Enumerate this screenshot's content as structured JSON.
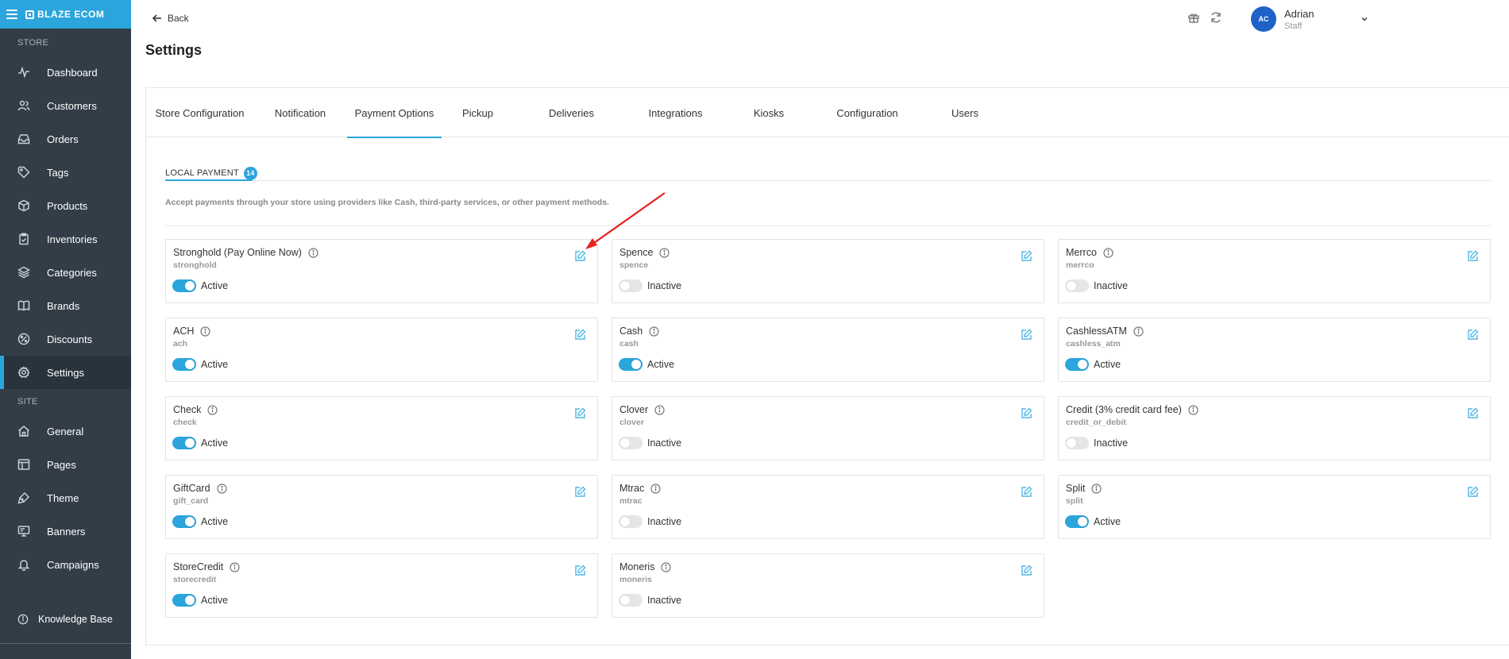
{
  "sidebar": {
    "brand": "BLAZE ECOM",
    "store_section": "STORE",
    "site_section": "SITE",
    "store_items": [
      {
        "label": "Dashboard",
        "icon": "activity-icon"
      },
      {
        "label": "Customers",
        "icon": "users-icon"
      },
      {
        "label": "Orders",
        "icon": "inbox-icon"
      },
      {
        "label": "Tags",
        "icon": "tag-icon"
      },
      {
        "label": "Products",
        "icon": "package-icon"
      },
      {
        "label": "Inventories",
        "icon": "clipboard-icon"
      },
      {
        "label": "Categories",
        "icon": "layers-icon"
      },
      {
        "label": "Brands",
        "icon": "book-icon"
      },
      {
        "label": "Discounts",
        "icon": "percent-icon"
      },
      {
        "label": "Settings",
        "icon": "gear-icon"
      }
    ],
    "site_items": [
      {
        "label": "General",
        "icon": "home-icon"
      },
      {
        "label": "Pages",
        "icon": "layout-icon"
      },
      {
        "label": "Theme",
        "icon": "brush-icon"
      },
      {
        "label": "Banners",
        "icon": "monitor-icon"
      },
      {
        "label": "Campaigns",
        "icon": "bell-icon"
      }
    ],
    "knowledge_base": "Knowledge Base",
    "active_item": "Settings"
  },
  "header": {
    "back_label": "Back",
    "page_title": "Settings",
    "user": {
      "initials": "AC",
      "name": "Adrian",
      "role": "Staff"
    }
  },
  "tabs": [
    "Store Configuration",
    "Notification",
    "Payment Options",
    "Pickup",
    "Deliveries",
    "Integrations",
    "Kiosks",
    "Configuration",
    "Users"
  ],
  "active_tab": "Payment Options",
  "subtab": {
    "label": "LOCAL PAYMENT",
    "count": "14"
  },
  "description": "Accept payments through your store using providers like Cash, third-party services, or other payment methods.",
  "payments": [
    {
      "name": "Stronghold (Pay Online Now)",
      "code": "stronghold",
      "status": "Active",
      "enabled": true
    },
    {
      "name": "Spence",
      "code": "spence",
      "status": "Inactive",
      "enabled": false
    },
    {
      "name": "Merrco",
      "code": "merrco",
      "status": "Inactive",
      "enabled": false
    },
    {
      "name": "ACH",
      "code": "ach",
      "status": "Active",
      "enabled": true
    },
    {
      "name": "Cash",
      "code": "cash",
      "status": "Active",
      "enabled": true
    },
    {
      "name": "CashlessATM",
      "code": "cashless_atm",
      "status": "Active",
      "enabled": true
    },
    {
      "name": "Check",
      "code": "check",
      "status": "Active",
      "enabled": true
    },
    {
      "name": "Clover",
      "code": "clover",
      "status": "Inactive",
      "enabled": false
    },
    {
      "name": "Credit (3% credit card fee)",
      "code": "credit_or_debit",
      "status": "Inactive",
      "enabled": false
    },
    {
      "name": "GiftCard",
      "code": "gift_card",
      "status": "Active",
      "enabled": true
    },
    {
      "name": "Mtrac",
      "code": "mtrac",
      "status": "Inactive",
      "enabled": false
    },
    {
      "name": "Split",
      "code": "split",
      "status": "Active",
      "enabled": true
    },
    {
      "name": "StoreCredit",
      "code": "storecredit",
      "status": "Active",
      "enabled": true
    },
    {
      "name": "Moneris",
      "code": "moneris",
      "status": "Inactive",
      "enabled": false
    }
  ],
  "colors": {
    "accent": "#2ba5dc",
    "sidebar": "#323d48",
    "annotation_arrow": "#e8211d"
  }
}
